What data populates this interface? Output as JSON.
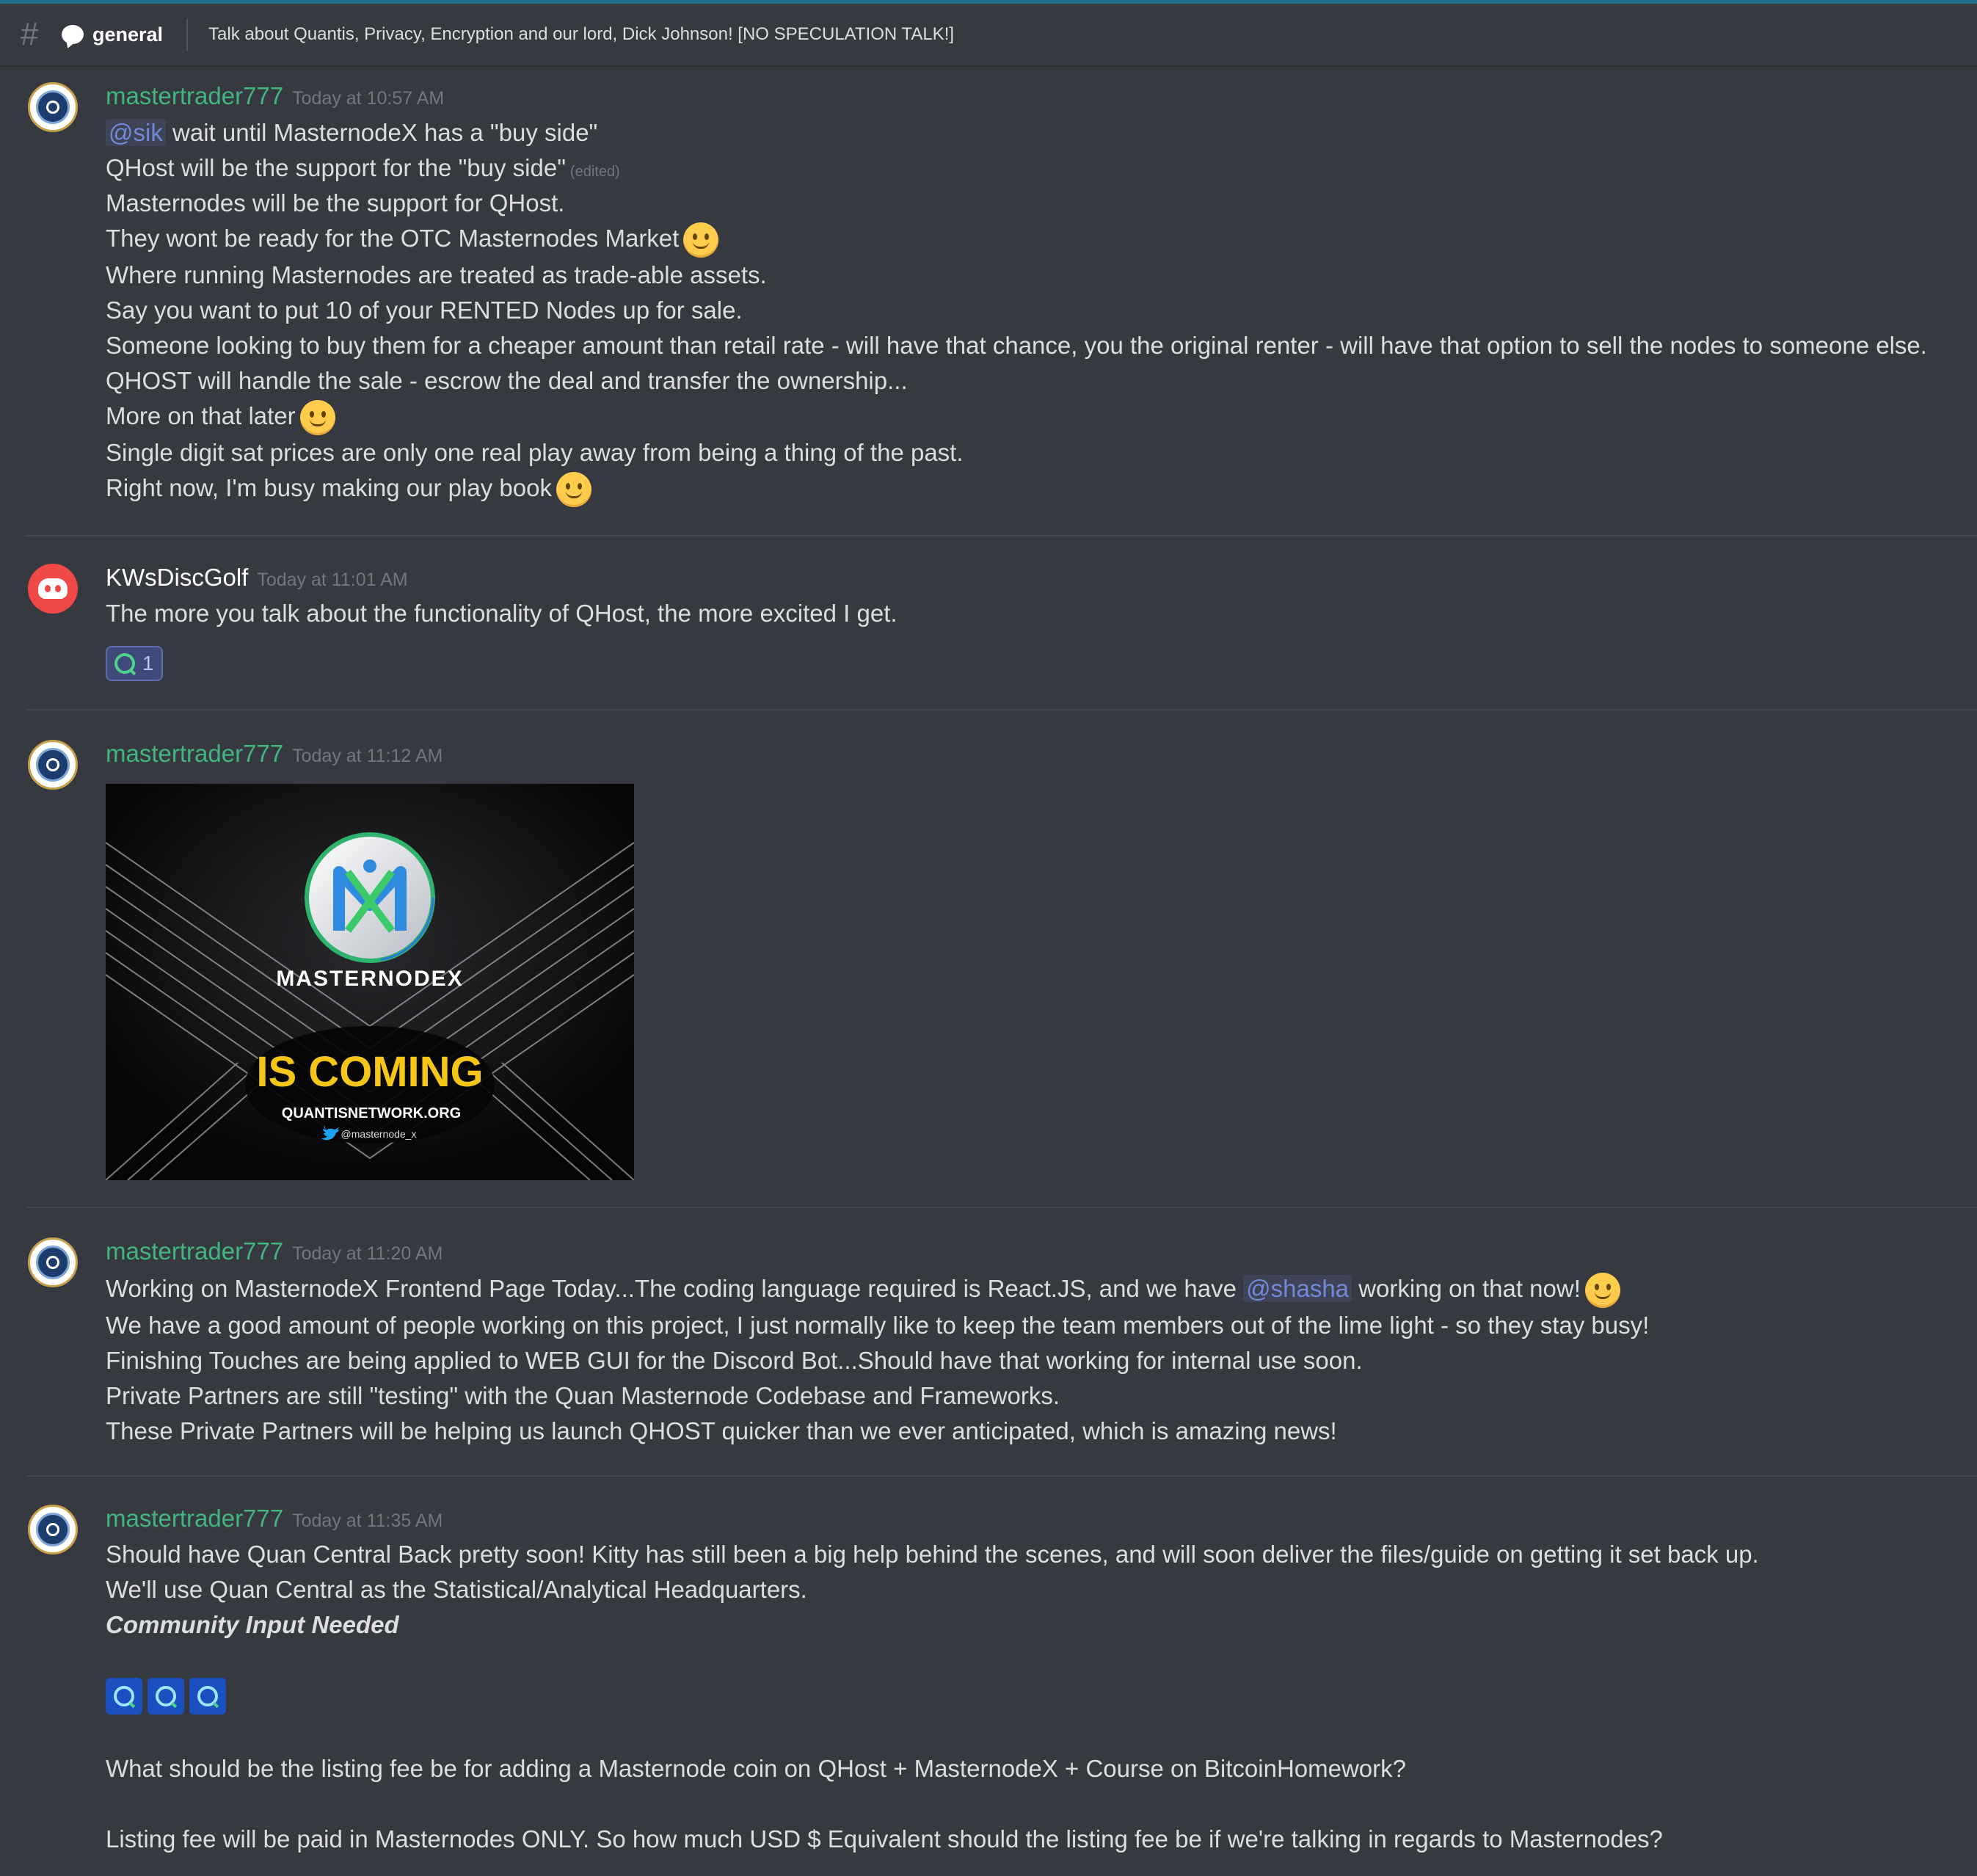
{
  "channel": {
    "name": "general",
    "topic": "Talk about Quantis, Privacy, Encryption and our lord, Dick Johnson! [NO SPECULATION TALK!]",
    "hash_icon": "#"
  },
  "messages": {
    "m1": {
      "username": "mastertrader777",
      "timestamp": "Today at 10:57 AM",
      "mention": "@sik",
      "l1": "wait until MasternodeX has a \"buy side\"",
      "l2": "QHost will be the support for the \"buy side\"",
      "edited": "(edited)",
      "l3": "Masternodes will be the support for QHost.",
      "l4": "They wont be ready for the OTC Masternodes Market",
      "l5": "Where running Masternodes are treated as trade-able assets.",
      "l6": "Say you want to put 10 of your RENTED Nodes up for sale.",
      "l7": "Someone looking to buy them for a cheaper amount than retail rate - will have that chance, you the original renter - will have that option to sell the nodes to someone else.",
      "l8": "QHOST will handle the sale - escrow the deal and transfer the ownership...",
      "l9": "More on that later",
      "l10": "Single digit sat prices are only one real play away from being a thing of the past.",
      "l11": "Right now, I'm busy making our play book"
    },
    "m2": {
      "username": "KWsDiscGolf",
      "timestamp": "Today at 11:01 AM",
      "l1": "The more you talk about the functionality of QHost, the more excited I get.",
      "reaction_count": "1"
    },
    "m3": {
      "username": "mastertrader777",
      "timestamp": "Today at 11:12 AM",
      "image": {
        "brand": "MASTERNODEX",
        "headline": "IS COMING",
        "site": "QUANTISNETWORK.ORG",
        "handle": "@masternode_x"
      }
    },
    "m4": {
      "username": "mastertrader777",
      "timestamp": "Today at 11:20 AM",
      "l1a": "Working on MasternodeX Frontend Page Today...The coding language required is React.JS, and we have",
      "mention": "@shasha",
      "l1b": "working on that now!",
      "l2": "We have a good amount of people working on this project, I just normally like to keep the team members out of the lime light - so they stay busy!",
      "l3": "Finishing Touches are being applied to WEB GUI for the Discord Bot...Should have that working for internal use soon.",
      "l4": "Private Partners are still \"testing\" with the Quan Masternode Codebase and Frameworks.",
      "l5": "These Private Partners will be helping us launch QHOST quicker than we ever anticipated, which is amazing news!"
    },
    "m5": {
      "username": "mastertrader777",
      "timestamp": "Today at 11:35 AM",
      "l1": "Should have Quan Central Back pretty soon! Kitty has still been a big help behind the scenes, and will soon deliver the files/guide on getting it set back up.",
      "l2": "We'll use Quan Central as the Statistical/Analytical Headquarters.",
      "l3": "Community Input Needed",
      "l4": "What should be the listing fee be for adding a Masternode coin on QHost + MasternodeX + Course on BitcoinHomework?",
      "l5": "Listing fee will be paid in Masternodes ONLY. So how much USD $ Equivalent should the listing fee be if we're talking in regards to Masternodes?"
    }
  },
  "colors": {
    "background": "#36393f",
    "username_green": "#43b581",
    "mention": "#7289da",
    "headline_yellow": "#f5c518"
  }
}
